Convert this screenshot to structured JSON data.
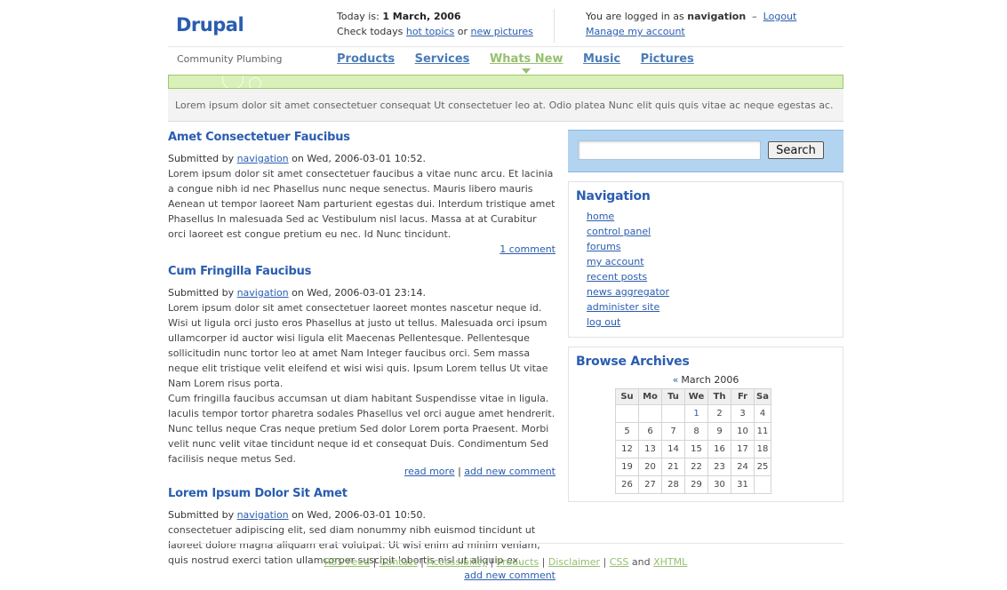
{
  "site": {
    "name": "Drupal",
    "slogan": "Community Plumbing"
  },
  "info": {
    "today_label": "Today is:",
    "today_date": "1 March, 2006",
    "check_text": "Check todays",
    "hot_topics": "hot topics",
    "or": "or",
    "new_pictures": "new pictures"
  },
  "user": {
    "logged_in_text": "You are logged in as",
    "username": "navigation",
    "dash": "–",
    "logout": "Logout",
    "manage_account": "Manage my account"
  },
  "nav": {
    "items": [
      "Products",
      "Services",
      "Whats New",
      "Music",
      "Pictures"
    ],
    "active_index": 2
  },
  "intro_text": "Lorem ipsum dolor sit amet consectetuer consequat Ut consectetuer leo at. Odio platea Nunc elit quis quis vitae ac neque egestas ac.",
  "posts": [
    {
      "title": "Amet Consectetuer Faucibus",
      "submitted_by": "Submitted by",
      "author": "navigation",
      "date": "on Wed, 2006-03-01 10:52.",
      "body": "Lorem ipsum dolor sit amet consectetuer faucibus a vitae nunc arcu. Et lacinia a congue nibh id nec Phasellus nunc neque senectus. Mauris libero mauris Aenean ut tempor laoreet Nam parturient egestas dui. Interdum tristique amet Phasellus In malesuada Sed ac Vestibulum nisl lacus. Massa at at Curabitur orci laoreet est congue pretium eu nec. Id Nunc tincidunt.",
      "links": [
        "1 comment"
      ]
    },
    {
      "title": "Cum Fringilla Faucibus",
      "submitted_by": "Submitted by",
      "author": "navigation",
      "date": "on Wed, 2006-03-01 23:14.",
      "body": "Lorem ipsum dolor sit amet consectetuer laoreet montes nascetur neque id. Wisi ut ligula orci justo eros Phasellus at justo ut tellus. Malesuada orci ipsum ullamcorper id auctor wisi ligula elit Maecenas Pellentesque. Pellentesque sollicitudin nunc tortor leo at amet Nam Integer faucibus orci. Sem massa neque elit tristique velit eleifend et wisi wisi quis. Ipsum Lorem tellus Ut vitae Nam Lorem risus porta.",
      "body2": "Cum fringilla faucibus accumsan ut diam habitant Suspendisse vitae in ligula. Iaculis tempor tortor pharetra sodales Phasellus vel orci augue amet hendrerit. Nunc tellus neque Cras neque pretium Sed dolor Lorem porta Praesent. Morbi velit nunc velit vitae tincidunt neque id et consequat Duis. Condimentum Sed facilisis neque metus Sed.",
      "links": [
        "read more",
        "add new comment"
      ]
    },
    {
      "title": "Lorem Ipsum Dolor Sit Amet",
      "submitted_by": "Submitted by",
      "author": "navigation",
      "date": "on Wed, 2006-03-01 10:50.",
      "body": "consectetuer adipiscing elit, sed diam nonummy nibh euismod tincidunt ut laoreet dolore magna aliquam erat volutpat. Ut wisi enim ad minim veniam, quis nostrud exerci tation ullamcorper suscipit lobortis nisl ut aliquip ex.",
      "links": [
        "add new comment"
      ]
    }
  ],
  "search": {
    "value": "",
    "button": "Search"
  },
  "navigation_block": {
    "title": "Navigation",
    "items": [
      "home",
      "control panel",
      "forums",
      "my account",
      "recent posts",
      "news aggregator",
      "administer site",
      "log out"
    ]
  },
  "archives": {
    "title": "Browse Archives",
    "prev": "«",
    "month": "March 2006",
    "weekdays": [
      "Su",
      "Mo",
      "Tu",
      "We",
      "Th",
      "Fr",
      "Sa"
    ],
    "weeks": [
      [
        "",
        "",
        "",
        "1",
        "2",
        "3",
        "4"
      ],
      [
        "5",
        "6",
        "7",
        "8",
        "9",
        "10",
        "11"
      ],
      [
        "12",
        "13",
        "14",
        "15",
        "16",
        "17",
        "18"
      ],
      [
        "19",
        "20",
        "21",
        "22",
        "23",
        "24",
        "25"
      ],
      [
        "26",
        "27",
        "28",
        "29",
        "30",
        "31",
        ""
      ]
    ],
    "linked_day": "1"
  },
  "footer": {
    "links": [
      "RSS Feed",
      "Contact",
      "Accessibility",
      "Products",
      "Disclaimer",
      "CSS"
    ],
    "and": "and",
    "last_link": "XHTML"
  },
  "colors": {
    "link": "#2a5db0",
    "accent_green": "#96c06e",
    "search_bg": "#b3d4f0"
  }
}
